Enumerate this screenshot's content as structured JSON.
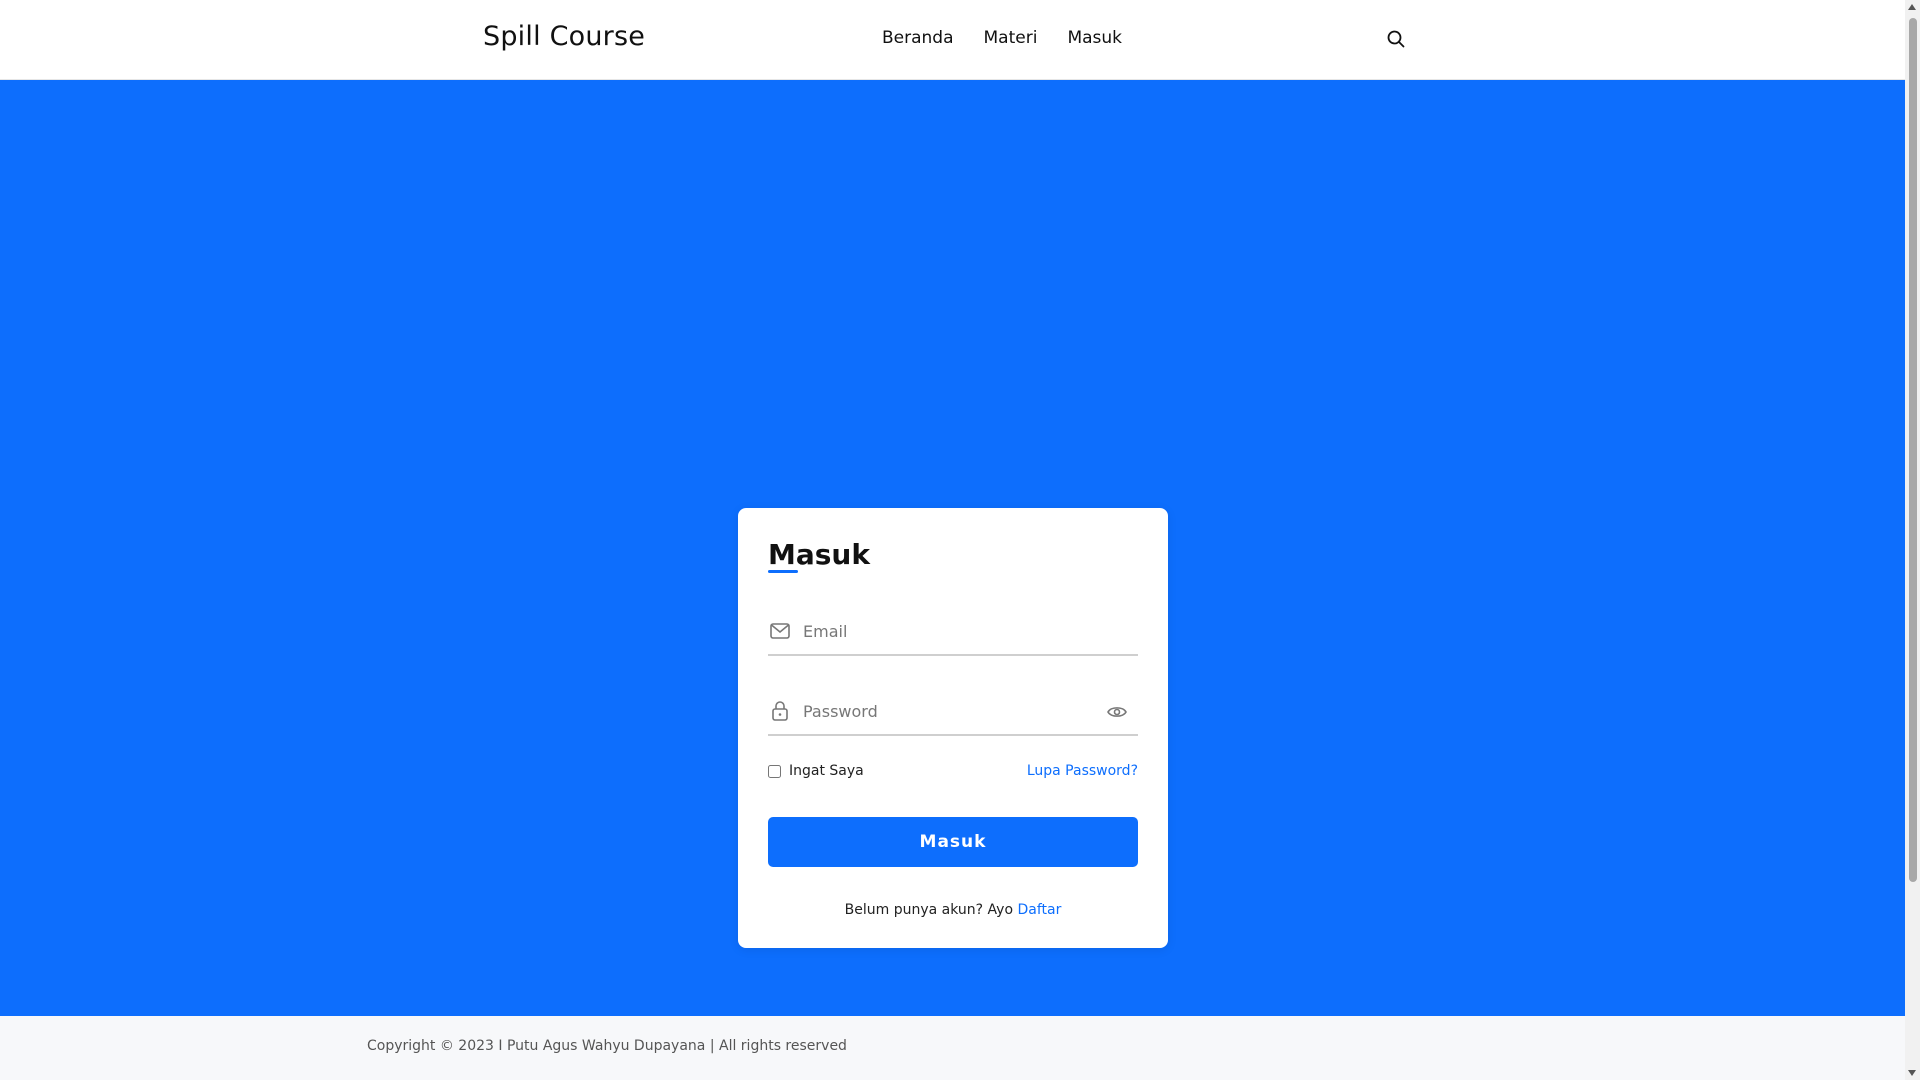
{
  "header": {
    "brand": "Spill Course",
    "nav": [
      {
        "label": "Beranda"
      },
      {
        "label": "Materi"
      },
      {
        "label": "Masuk"
      }
    ],
    "search_icon": "search-icon"
  },
  "login": {
    "title": "Masuk",
    "email": {
      "placeholder": "Email",
      "value": "",
      "icon": "envelope-icon"
    },
    "password": {
      "placeholder": "Password",
      "value": "",
      "icon": "lock-icon",
      "toggle_icon": "eye-icon"
    },
    "remember_label": "Ingat Saya",
    "remember_checked": false,
    "forgot_label": "Lupa Password?",
    "submit_label": "Masuk",
    "register_prompt": "Belum punya akun? Ayo",
    "register_link": "Daftar"
  },
  "footer": {
    "copyright": "Copyright © 2023 I Putu Agus Wahyu Dupayana | All rights reserved"
  },
  "colors": {
    "primary": "#0d6efd",
    "footer_bg": "#f7f8fa"
  }
}
